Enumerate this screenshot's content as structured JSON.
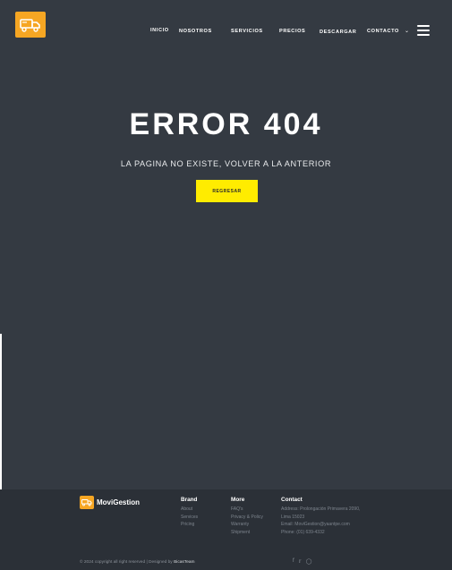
{
  "header": {
    "nav": [
      {
        "label": "INICIO"
      },
      {
        "label": "NOSOTROS"
      },
      {
        "label": "SERVICIOS"
      },
      {
        "label": "PRECIOS"
      },
      {
        "label": "DESCARGAR"
      },
      {
        "label": "CONTACTO"
      }
    ]
  },
  "hero": {
    "title": "ERROR 404",
    "subtitle": "LA PAGINA NO EXISTE, VOLVER A LA ANTERIOR",
    "button": "REGRESAR"
  },
  "footer": {
    "brand": "MoviGestion",
    "columns": [
      {
        "title": "Brand",
        "links": [
          "About",
          "Services",
          "Pricing"
        ]
      },
      {
        "title": "More",
        "links": [
          "FAQ's",
          "Privacy & Policy",
          "Warranty",
          "Shipment"
        ]
      },
      {
        "title": "Contact",
        "links": [
          "Address: Prolongación Primavera 2090,",
          "Lima 15023",
          "Email: MoviGestion@yaantpe.com",
          "Phone: (01) 639-4332"
        ]
      }
    ],
    "copyright_prefix": "© 2024 copyright all right reserved | Designed by",
    "copyright_author": "BicasTeam"
  },
  "colors": {
    "background": "#343a42",
    "footer": "#2b3037",
    "accent_button": "#ffec00",
    "logo": "#f6a623"
  }
}
